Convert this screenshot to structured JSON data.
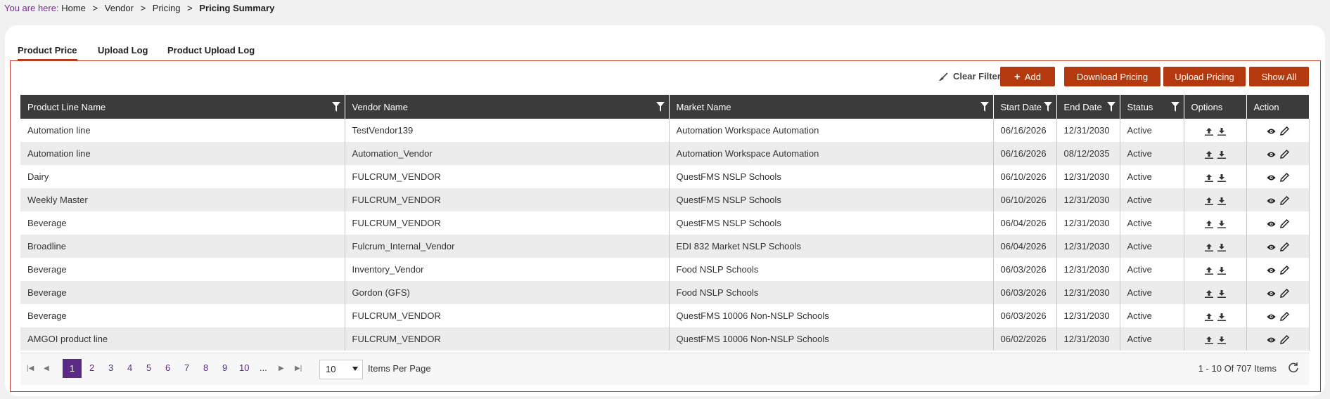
{
  "breadcrumb": {
    "lead": "You are here:",
    "items": [
      "Home",
      "Vendor",
      "Pricing"
    ],
    "separator": ">",
    "current": "Pricing Summary"
  },
  "tabs": [
    {
      "label": "Product Price",
      "active": true
    },
    {
      "label": "Upload Log",
      "active": false
    },
    {
      "label": "Product Upload Log",
      "active": false
    }
  ],
  "toolbar": {
    "clear_filter": "Clear Filter",
    "add": "Add",
    "download": "Download Pricing",
    "upload": "Upload Pricing",
    "show_all": "Show All"
  },
  "columns": [
    "Product Line Name",
    "Vendor Name",
    "Market Name",
    "Start Date",
    "End Date",
    "Status",
    "Options",
    "Action"
  ],
  "rows": [
    [
      "Automation line",
      "TestVendor139",
      "Automation Workspace Automation",
      "06/16/2026",
      "12/31/2030",
      "Active"
    ],
    [
      "Automation line",
      "Automation_Vendor",
      "Automation Workspace Automation",
      "06/16/2026",
      "08/12/2035",
      "Active"
    ],
    [
      "Dairy",
      "FULCRUM_VENDOR",
      "QuestFMS NSLP Schools",
      "06/10/2026",
      "12/31/2030",
      "Active"
    ],
    [
      "Weekly Master",
      "FULCRUM_VENDOR",
      "QuestFMS NSLP Schools",
      "06/10/2026",
      "12/31/2030",
      "Active"
    ],
    [
      "Beverage",
      "FULCRUM_VENDOR",
      "QuestFMS NSLP Schools",
      "06/04/2026",
      "12/31/2030",
      "Active"
    ],
    [
      "Broadline",
      "Fulcrum_Internal_Vendor",
      "EDI 832 Market NSLP Schools",
      "06/04/2026",
      "12/31/2030",
      "Active"
    ],
    [
      "Beverage",
      "Inventory_Vendor",
      "Food NSLP Schools",
      "06/03/2026",
      "12/31/2030",
      "Active"
    ],
    [
      "Beverage",
      "Gordon (GFS)",
      "Food NSLP Schools",
      "06/03/2026",
      "12/31/2030",
      "Active"
    ],
    [
      "Beverage",
      "FULCRUM_VENDOR",
      "QuestFMS 10006 Non-NSLP Schools",
      "06/03/2026",
      "12/31/2030",
      "Active"
    ],
    [
      "AMGOI product line",
      "FULCRUM_VENDOR",
      "QuestFMS 10006 Non-NSLP Schools",
      "06/02/2026",
      "12/31/2030",
      "Active"
    ]
  ],
  "pager": {
    "pages": [
      "1",
      "2",
      "3",
      "4",
      "5",
      "6",
      "7",
      "8",
      "9",
      "10",
      "..."
    ],
    "current": "1",
    "per_page": "10",
    "per_page_label": "Items Per Page",
    "info": "1 - 10 Of 707 Items"
  },
  "colors": {
    "accent": "#b5390e",
    "header": "#3b3b3b",
    "pager_active": "#5b2a86"
  }
}
